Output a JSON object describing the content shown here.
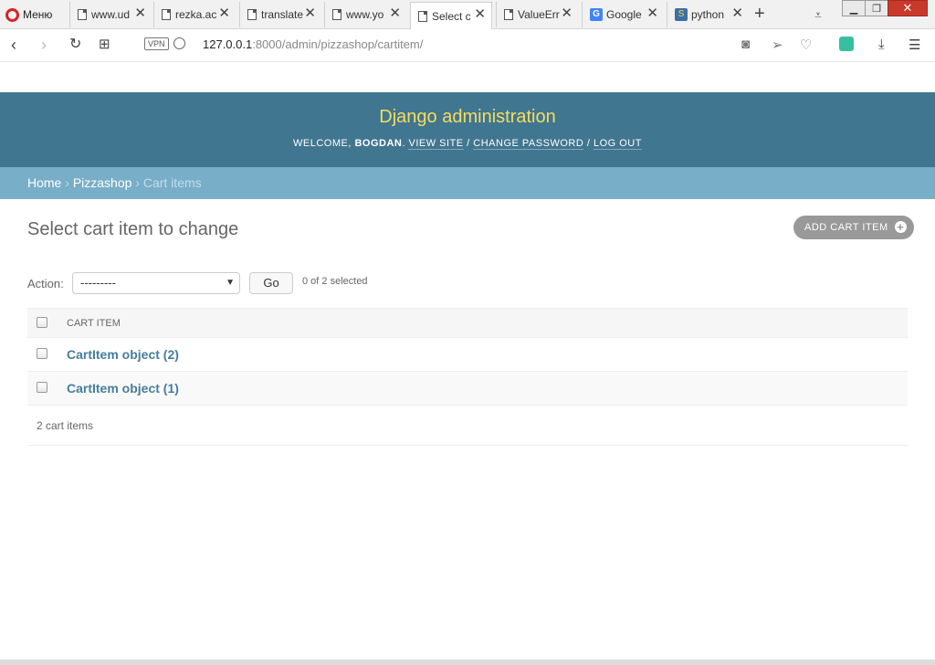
{
  "browser": {
    "menu_label": "Меню",
    "tabs": [
      {
        "label": "www.ud",
        "icon": "doc-icon",
        "active": false
      },
      {
        "label": "rezka.ac",
        "icon": "doc-icon",
        "active": false
      },
      {
        "label": "translate",
        "icon": "doc-icon",
        "active": false
      },
      {
        "label": "www.yo",
        "icon": "doc-icon",
        "active": false
      },
      {
        "label": "Select c",
        "icon": "doc-icon",
        "active": true
      },
      {
        "label": "ValueErr",
        "icon": "doc-icon",
        "active": false
      },
      {
        "label": "Google",
        "icon": "google-translate-icon",
        "active": false
      },
      {
        "label": "python",
        "icon": "python-icon",
        "active": false
      }
    ],
    "new_tab_symbol": "+",
    "vpn_label": "VPN",
    "url_host": "127.0.0.1",
    "url_path": ":8000/admin/pizzashop/cartitem/"
  },
  "admin": {
    "site_name": "Django administration",
    "welcome_prefix": "Welcome,",
    "username": "bogdan",
    "view_site": "View site",
    "change_password": "Change password",
    "log_out": "Log out",
    "sep": "/",
    "breadcrumbs": {
      "home": "Home",
      "app": "Pizzashop",
      "current": "Cart items",
      "sep": "›"
    },
    "title": "Select cart item to change",
    "add_button": "Add cart item",
    "action": {
      "label": "Action:",
      "selected_option": "---------",
      "go_label": "Go",
      "selection_counter": "0 of 2 selected"
    },
    "table": {
      "column_header": "Cart item",
      "rows": [
        {
          "label": "CartItem object (2)"
        },
        {
          "label": "CartItem object (1)"
        }
      ]
    },
    "result_count": "2 cart items"
  },
  "colors": {
    "header_bg": "#417690",
    "site_name": "#f5dd5d",
    "breadcrumb_bg": "#79aec8",
    "link": "#447e9b",
    "add_button_bg": "#999999"
  }
}
